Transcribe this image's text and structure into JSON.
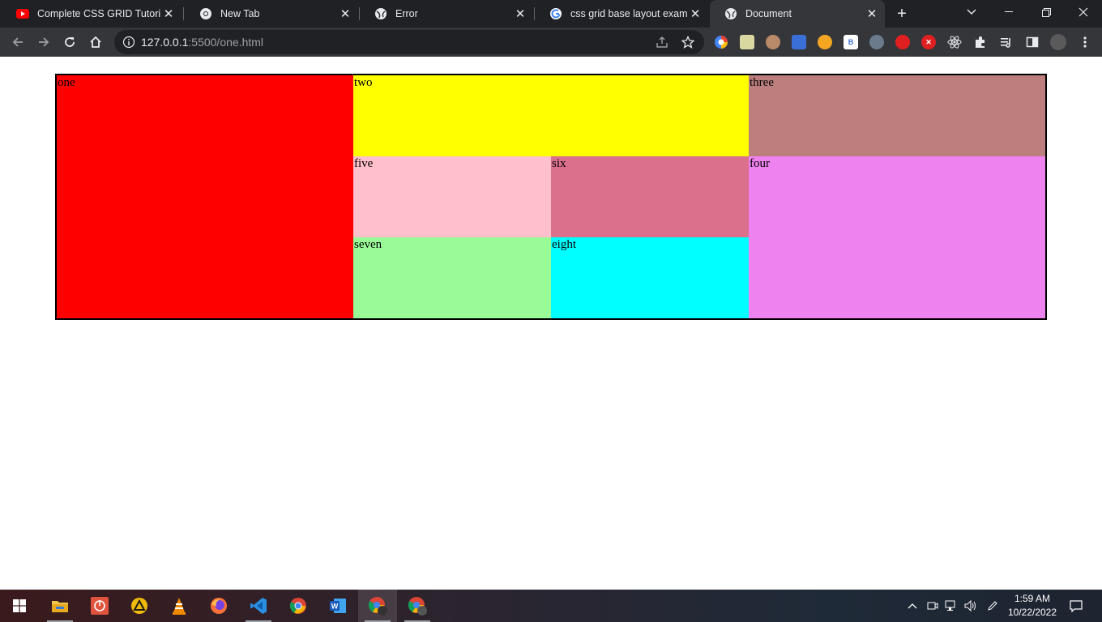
{
  "browser": {
    "tabs": [
      {
        "title": "Complete CSS GRID Tutorial",
        "icon": "youtube-icon",
        "active": false
      },
      {
        "title": "New Tab",
        "icon": "chrome-icon",
        "active": false
      },
      {
        "title": "Error",
        "icon": "globe-icon",
        "active": false
      },
      {
        "title": "css grid base layout example",
        "icon": "google-icon",
        "active": false
      },
      {
        "title": "Document",
        "icon": "globe-icon",
        "active": true
      }
    ],
    "close_glyph": "✕",
    "new_tab_glyph": "+",
    "url_host": "127.0.0.1",
    "url_path": ":5500/one.html"
  },
  "page": {
    "grid_items": {
      "one": "one",
      "two": "two",
      "three": "three",
      "four": "four",
      "five": "five",
      "six": "six",
      "seven": "seven",
      "eight": "eight"
    },
    "colors": {
      "one": "#ff0000",
      "two": "#ffff00",
      "three": "#bc7f7e",
      "four": "#ee82ee",
      "five": "#ffc0cb",
      "six": "#db708d",
      "seven": "#98fb98",
      "eight": "#00ffff"
    }
  },
  "taskbar": {
    "apps": [
      "file-explorer",
      "power-app",
      "arch-app",
      "vlc",
      "firefox",
      "vscode",
      "chrome",
      "word",
      "chrome-profile-1",
      "chrome-profile-2"
    ],
    "time": "1:59 AM",
    "date": "10/22/2022"
  }
}
